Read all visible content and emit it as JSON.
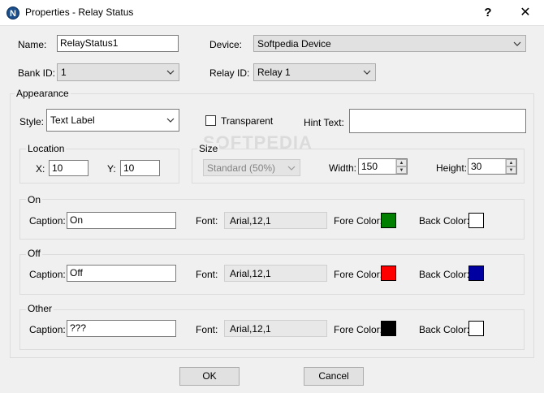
{
  "window": {
    "title": "Properties - Relay Status",
    "app_icon_letter": "N",
    "help_glyph": "?",
    "close_glyph": "✕"
  },
  "watermark": "SOFTPEDIA",
  "general": {
    "name_label": "Name:",
    "name_value": "RelayStatus1",
    "device_label": "Device:",
    "device_value": "Softpedia Device",
    "bank_label": "Bank ID:",
    "bank_value": "1",
    "relay_label": "Relay ID:",
    "relay_value": "Relay 1"
  },
  "appearance": {
    "title": "Appearance",
    "style_label": "Style:",
    "style_value": "Text Label",
    "transparent_label": "Transparent",
    "transparent_checked": false,
    "hint_label": "Hint Text:",
    "hint_value": "",
    "location": {
      "title": "Location",
      "x_label": "X:",
      "x_value": "10",
      "y_label": "Y:",
      "y_value": "10"
    },
    "size": {
      "title": "Size",
      "preset_value": "Standard    (50%)",
      "width_label": "Width:",
      "width_value": "150",
      "height_label": "Height:",
      "height_value": "30"
    }
  },
  "states": [
    {
      "title": "On",
      "caption_label": "Caption:",
      "caption_value": "On",
      "font_label": "Font:",
      "font_value": "Arial,12,1",
      "fore_label": "Fore Color:",
      "fore_color": "#007f00",
      "back_label": "Back Color:",
      "back_color": "#ffffff"
    },
    {
      "title": "Off",
      "caption_label": "Caption:",
      "caption_value": "Off",
      "font_label": "Font:",
      "font_value": "Arial,12,1",
      "fore_label": "Fore Color:",
      "fore_color": "#ff0000",
      "back_label": "Back Color:",
      "back_color": "#0000a0"
    },
    {
      "title": "Other",
      "caption_label": "Caption:",
      "caption_value": "???",
      "font_label": "Font:",
      "font_value": "Arial,12,1",
      "fore_label": "Fore Color:",
      "fore_color": "#000000",
      "back_label": "Back Color:",
      "back_color": "#ffffff"
    }
  ],
  "buttons": {
    "ok": "OK",
    "cancel": "Cancel"
  }
}
